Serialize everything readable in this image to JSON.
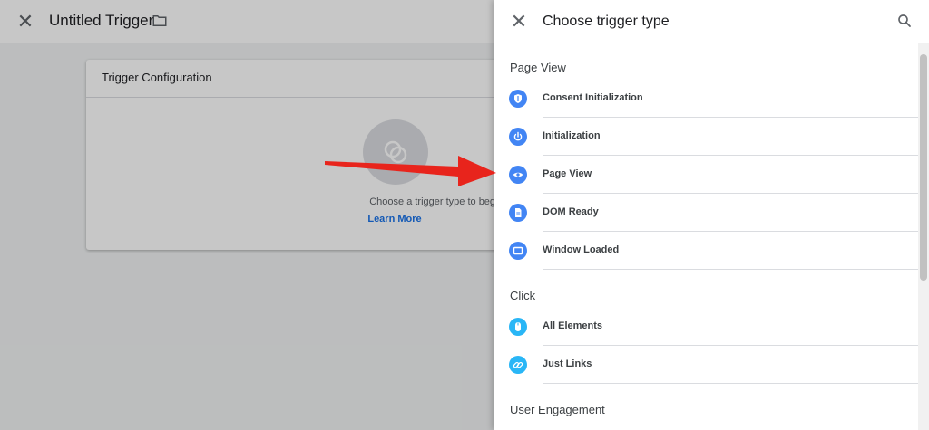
{
  "editor": {
    "title": "Untitled Trigger",
    "close_icon": "close-icon",
    "folder_icon": "folder-icon",
    "card": {
      "title": "Trigger Configuration",
      "hint": "Choose a trigger type to begin setup...",
      "link": "Learn More"
    }
  },
  "panel": {
    "title": "Choose trigger type",
    "close_icon": "close-icon",
    "search_icon": "search-icon",
    "sections": [
      {
        "label": "Page View",
        "items": [
          {
            "label": "Consent Initialization",
            "icon": "shield-icon",
            "color": "#4285f4"
          },
          {
            "label": "Initialization",
            "icon": "power-icon",
            "color": "#4285f4"
          },
          {
            "label": "Page View",
            "icon": "eye-icon",
            "color": "#4285f4"
          },
          {
            "label": "DOM Ready",
            "icon": "document-icon",
            "color": "#4285f4"
          },
          {
            "label": "Window Loaded",
            "icon": "window-icon",
            "color": "#4285f4"
          }
        ]
      },
      {
        "label": "Click",
        "items": [
          {
            "label": "All Elements",
            "icon": "mouse-icon",
            "color": "#29b6f6"
          },
          {
            "label": "Just Links",
            "icon": "link-icon",
            "color": "#29b6f6"
          }
        ]
      },
      {
        "label": "User Engagement",
        "items": []
      }
    ]
  },
  "annotation": {
    "arrow_color": "#e8241c",
    "arrow_target": "Page View"
  }
}
